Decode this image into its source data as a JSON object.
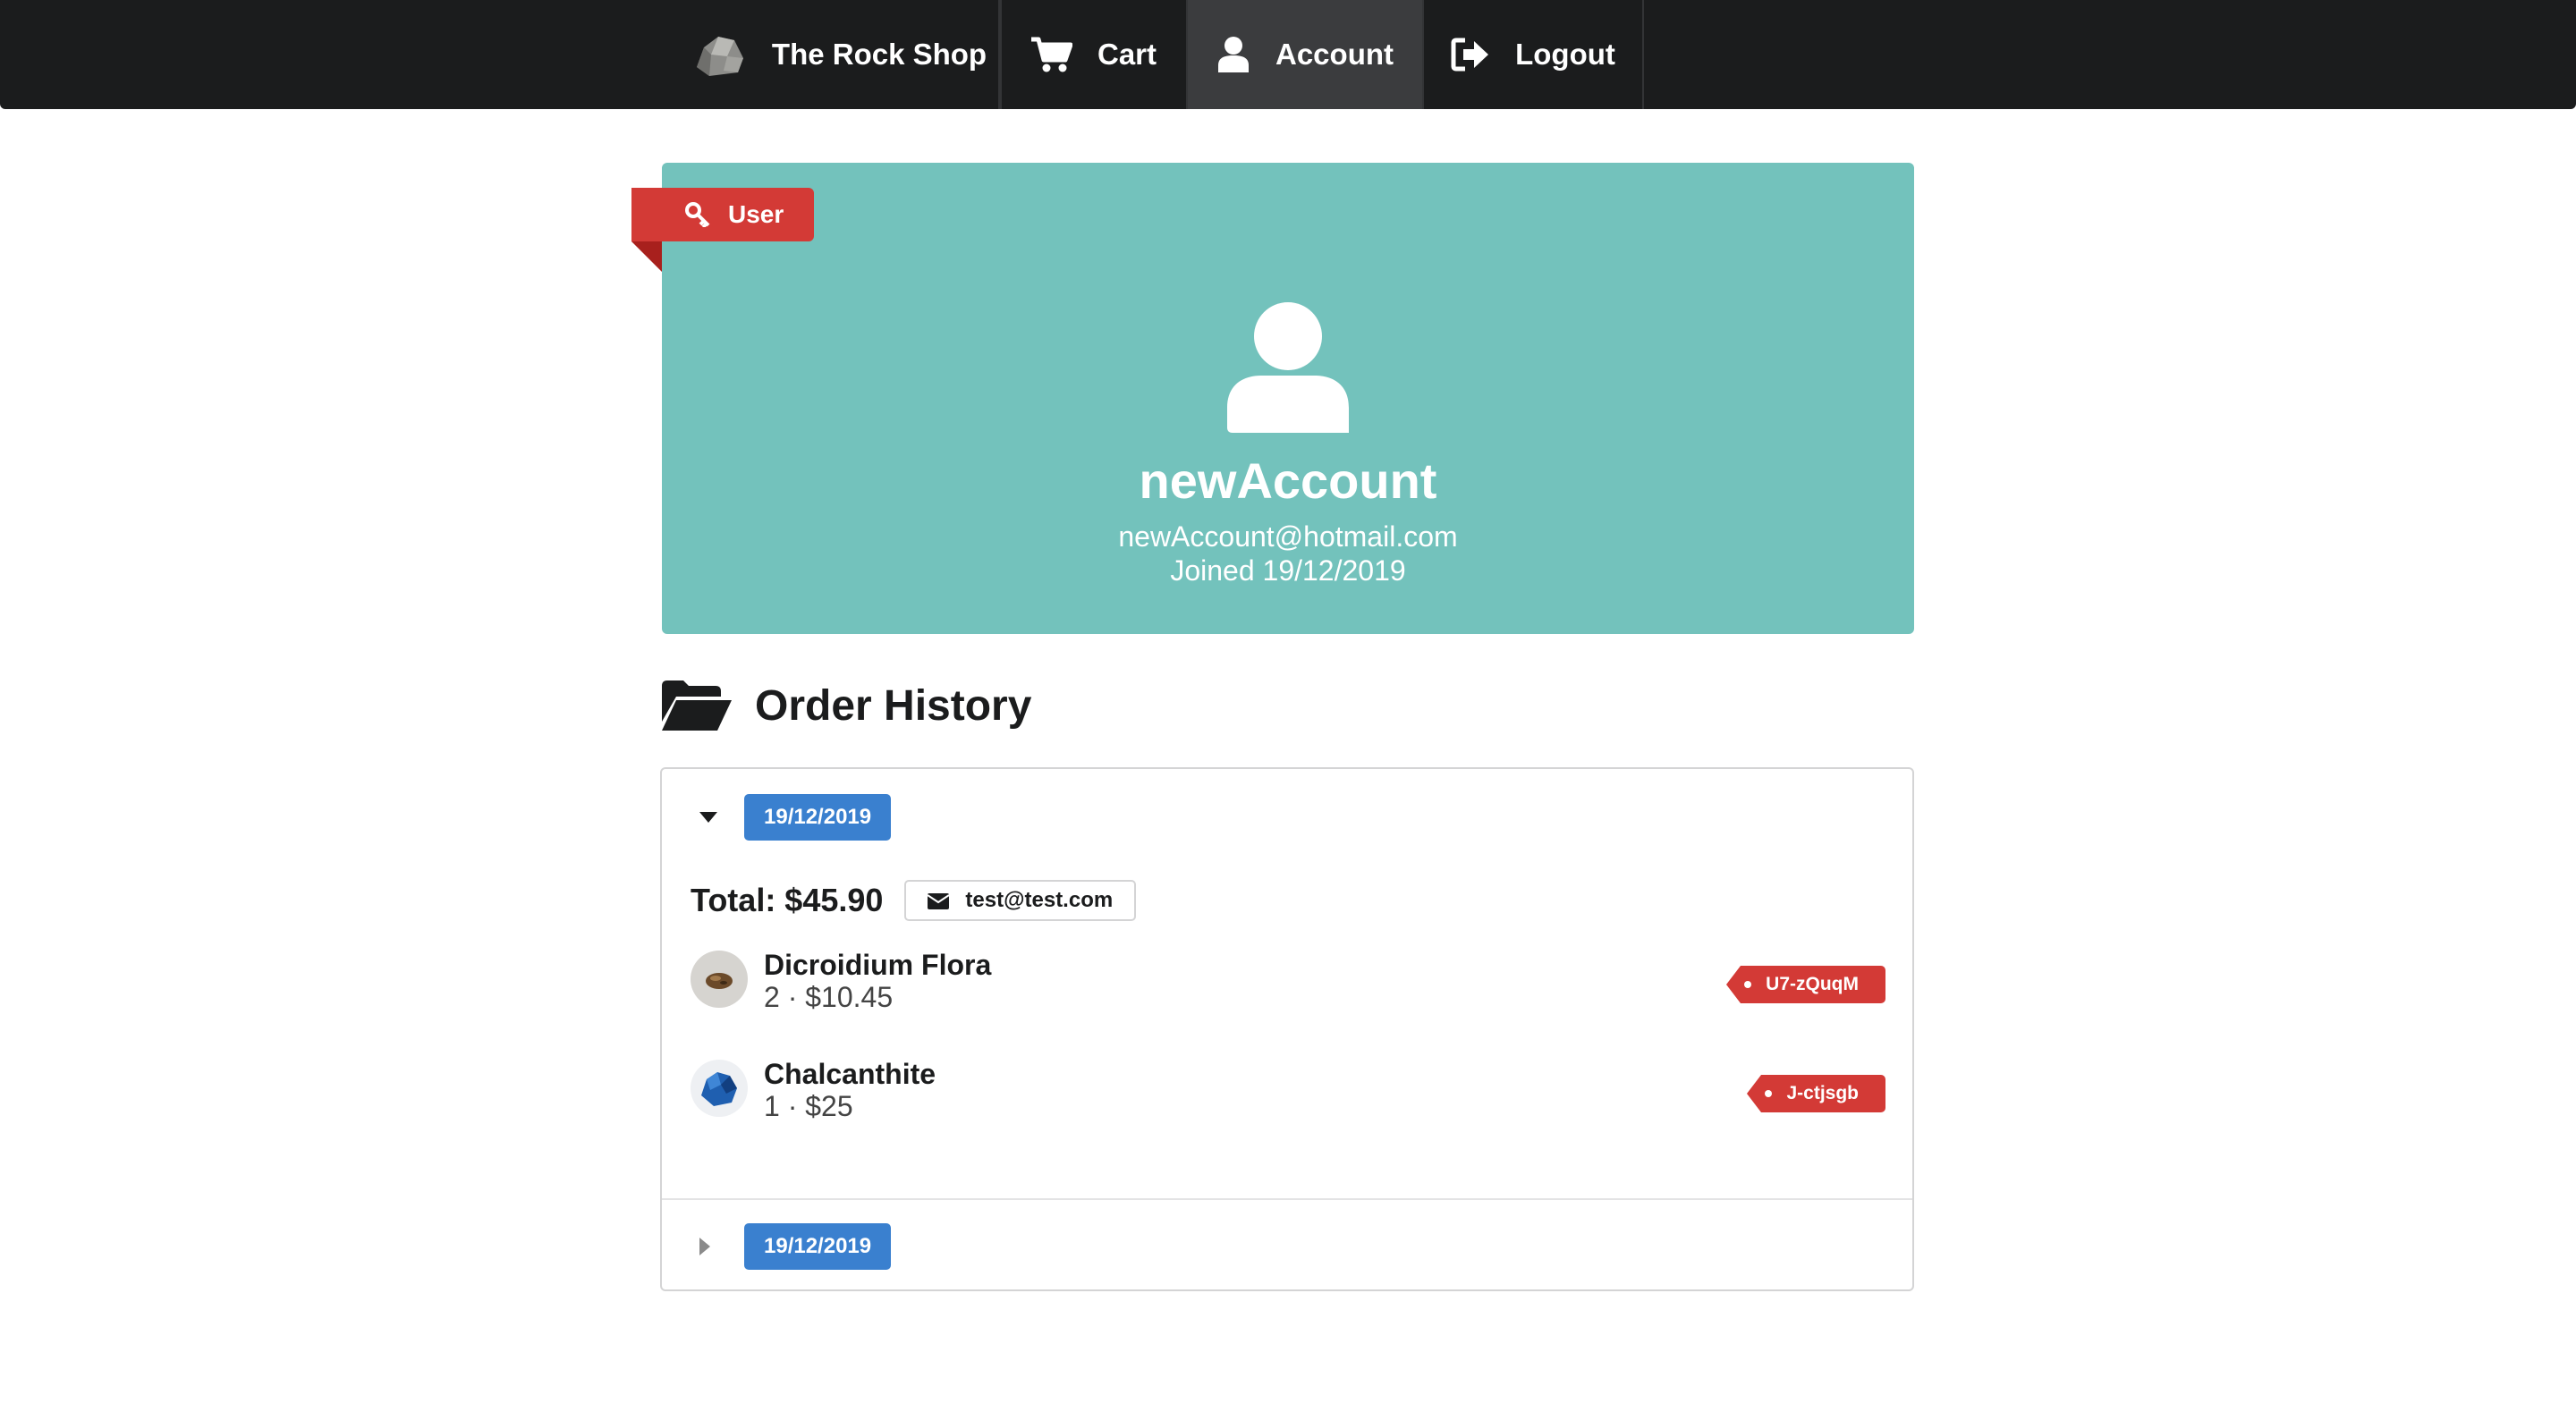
{
  "nav": {
    "brand_label": "The Rock Shop",
    "brand_icon": "rock-icon",
    "cart_label": "Cart",
    "cart_icon": "cart-icon",
    "account_label": "Account",
    "account_icon": "user-icon",
    "logout_label": "Logout",
    "logout_icon": "sign-out-icon",
    "active": "Account"
  },
  "profile": {
    "role_label": "User",
    "role_icon": "key-icon",
    "avatar_icon": "user-icon",
    "username": "newAccount",
    "email": "newAccount@hotmail.com",
    "joined": "Joined 19/12/2019"
  },
  "order_history": {
    "title": "Order History",
    "icon": "open-folder-icon",
    "orders": [
      {
        "date": "19/12/2019",
        "expanded": true,
        "total": "Total: $45.90",
        "email": "test@test.com",
        "items": [
          {
            "name": "Dicroidium Flora",
            "meta": "2 · $10.45",
            "code": "U7-zQuqM"
          },
          {
            "name": "Chalcanthite",
            "meta": "1 · $25",
            "code": "J-ctjsgb"
          }
        ]
      },
      {
        "date": "19/12/2019",
        "expanded": false
      }
    ]
  },
  "colors": {
    "nav_bg": "#1b1c1d",
    "card_bg": "#73c2bc",
    "ribbon": "#d33a36",
    "date_label": "#3a80cf"
  }
}
